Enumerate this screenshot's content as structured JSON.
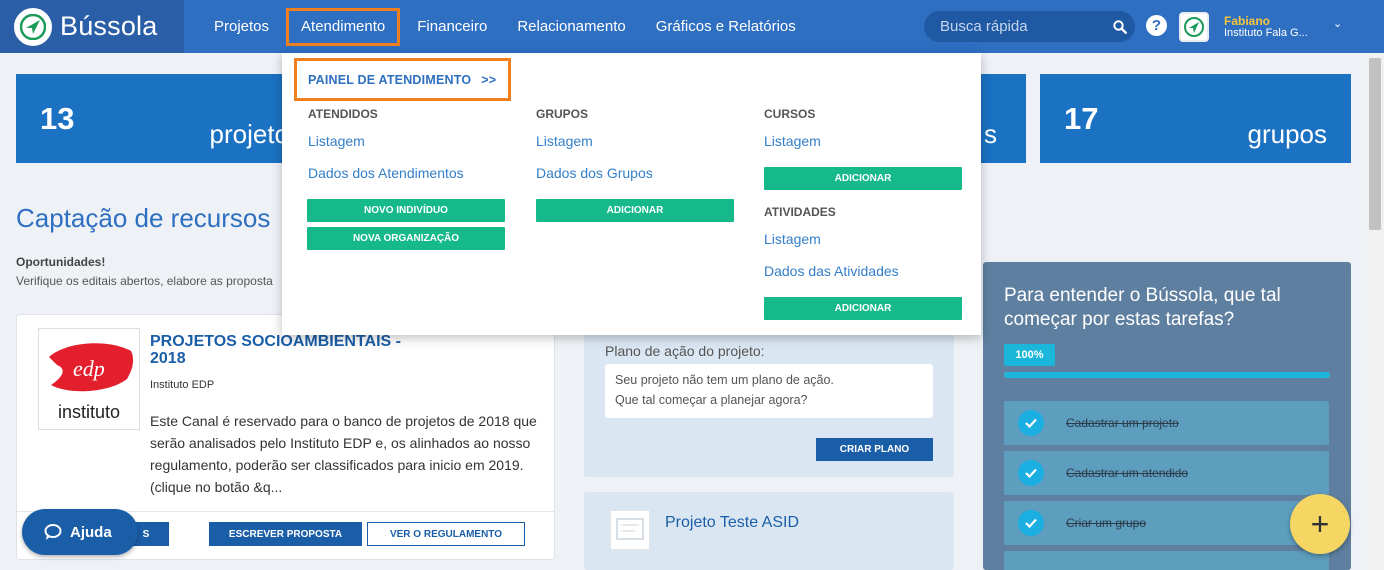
{
  "header": {
    "app_name": "Bússola",
    "nav": [
      {
        "label": "Projetos"
      },
      {
        "label": "Atendimento"
      },
      {
        "label": "Financeiro"
      },
      {
        "label": "Relacionamento"
      },
      {
        "label": "Gráficos e Relatórios"
      }
    ],
    "search_placeholder": "Busca rápida",
    "help": "?",
    "user_name": "Fabiano",
    "user_org": "Instituto Fala G...",
    "chevron": "⌄"
  },
  "tiles": [
    {
      "number": "13",
      "label": "projetos"
    },
    {
      "number": "",
      "label": "s"
    },
    {
      "number": "17",
      "label": "grupos"
    }
  ],
  "funding": {
    "title": "Captação de recursos",
    "opportunities": "Oportunidades!",
    "description": "Verifique os editais abertos, elabore as proposta"
  },
  "card": {
    "logo_text": "edp",
    "logo_caption": "instituto",
    "title": "PROJETOS SOCIOAMBIENTAIS - 2018",
    "organization": "Instituto EDP",
    "text": "Este Canal é reservado para o banco de projetos de 2018 que serão analisados pelo Instituto EDP e, os alinhados ao nosso regulamento, poderão ser classificados para inicio em 2019. (clique no botão &q...",
    "btn_partial": "S",
    "btn_write": "ESCREVER PROPOSTA",
    "btn_rules": "VER O REGULAMENTO"
  },
  "plan": {
    "label": "Plano de ação do projeto:",
    "line1": "Seu projeto não tem um plano de ação.",
    "line2": "Que tal começar a planejar agora?",
    "button": "CRIAR PLANO"
  },
  "project": {
    "title": "Projeto Teste ASID"
  },
  "tasks": {
    "title": "Para entender o Bússola, que tal começar por estas tarefas?",
    "progress_label": "100%",
    "progress_value": 1.0,
    "items": [
      {
        "label": "Cadastrar um projeto"
      },
      {
        "label": "Cadastrar um atendido"
      },
      {
        "label": "Criar um grupo"
      },
      {
        "label": ""
      }
    ]
  },
  "fab": "+",
  "help_button": "Ajuda",
  "dropdown": {
    "panel_link": "PAINEL DE ATENDIMENTO",
    "panel_arrows": ">>",
    "atendidos": {
      "heading": "ATENDIDOS",
      "listagem": "Listagem",
      "dados": "Dados dos Atendimentos",
      "btn_individuo": "NOVO INDIVÍDUO",
      "btn_organizacao": "NOVA ORGANIZAÇÃO"
    },
    "grupos": {
      "heading": "GRUPOS",
      "listagem": "Listagem",
      "dados": "Dados dos Grupos",
      "btn_add": "ADICIONAR"
    },
    "cursos": {
      "heading": "CURSOS",
      "listagem": "Listagem",
      "btn_add": "ADICIONAR"
    },
    "atividades": {
      "heading": "ATIVIDADES",
      "listagem": "Listagem",
      "dados": "Dados das Atividades",
      "btn_add": "ADICIONAR"
    }
  },
  "colors": {
    "header_blue": "#2e6fc1",
    "accent_orange": "#f07f1d",
    "green_button": "#15b98a",
    "tile_blue": "#1b71c2"
  }
}
